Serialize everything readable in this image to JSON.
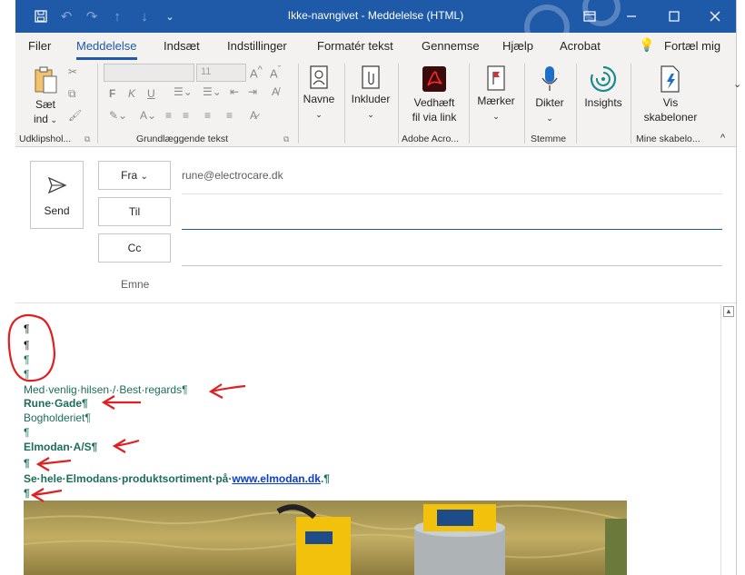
{
  "window": {
    "title": "Ikke-navngivet  -  Meddelelse (HTML)"
  },
  "menu": {
    "tabs": [
      "Filer",
      "Meddelelse",
      "Indsæt",
      "Indstillinger",
      "Formatér tekst",
      "Gennemse",
      "Hjælp",
      "Acrobat"
    ],
    "tell_me": "Fortæl mig"
  },
  "ribbon": {
    "paste_label_1": "Sæt",
    "paste_label_2": "ind",
    "font_size": "11",
    "names_label": "Navne",
    "attach_label": "Inkluder",
    "adobe_label_1": "Vedhæft",
    "adobe_label_2": "fil via link",
    "tags_label": "Mærker",
    "dictate_label": "Dikter",
    "insights_label": "Insights",
    "templates_label_1": "Vis",
    "templates_label_2": "skabeloner",
    "groups": {
      "clipboard": "Udklipshol...",
      "basic_text": "Grundlæggende tekst",
      "adobe": "Adobe Acro...",
      "voice": "Stemme",
      "templates": "Mine skabelo..."
    }
  },
  "header": {
    "send_label": "Send",
    "from_label": "Fra",
    "from_value": "rune@electrocare.dk",
    "to_label": "Til",
    "cc_label": "Cc",
    "subject_label": "Emne"
  },
  "body": {
    "line1": "¶",
    "line2": "¶",
    "line3": "¶",
    "line4": "¶",
    "greeting": "Med·venlig·hilsen·/·Best·regards¶",
    "name": "Rune·Gade¶",
    "dept": "Bogholderiet¶",
    "blank1": "¶",
    "company": "Elmodan·A/S¶",
    "blank2": "¶",
    "promo_text": "Se·hele·Elmodans·produktsortiment·på·",
    "promo_link": "www.elmodan.dk",
    "promo_end": ".¶",
    "blank3": "¶"
  },
  "colors": {
    "accent": "#1e5aa8",
    "annotation": "#e02020",
    "body_text": "#1c6d5a"
  }
}
